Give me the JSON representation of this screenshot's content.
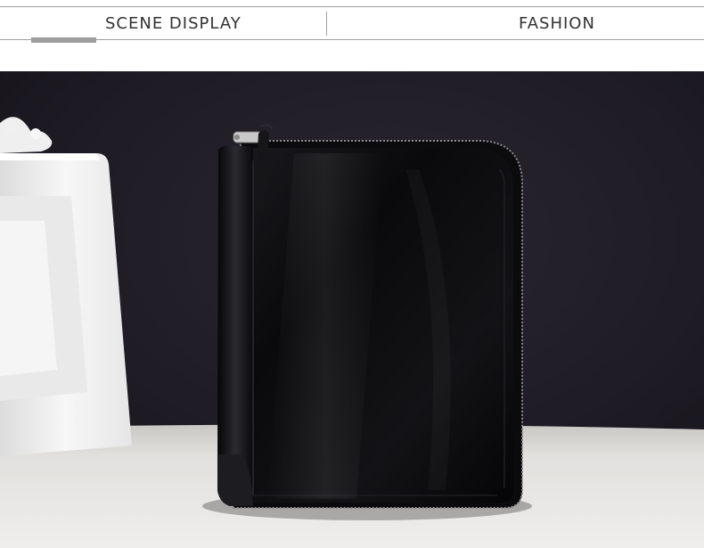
{
  "header": {
    "left_label": "SCENE DISPLAY",
    "right_label": "FASHION"
  },
  "photo": {
    "subject": "black-leather-zip-wallet",
    "colors": {
      "backdrop": "#1e1b24",
      "table": "#e6e4e1",
      "frame": "#f4f4f4",
      "wallet": "#0c0c0e",
      "zipper": "#b8b8b8"
    }
  }
}
